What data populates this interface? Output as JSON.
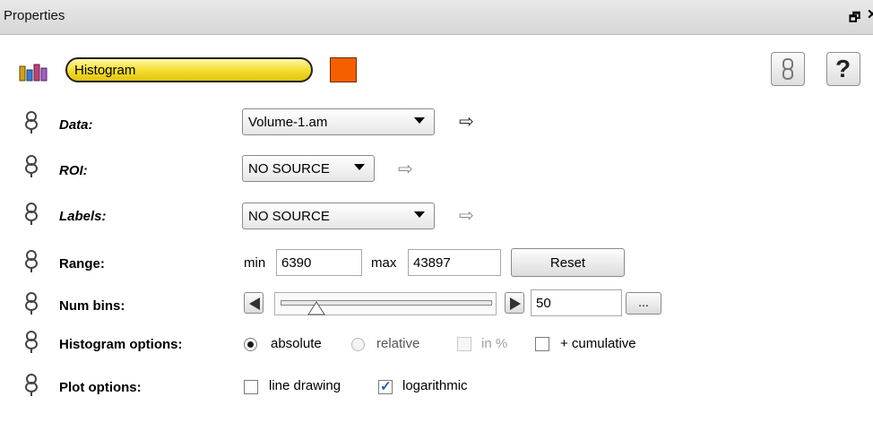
{
  "panel": {
    "title": "Properties"
  },
  "module": {
    "name": "Histogram",
    "color": "#f46000",
    "tool_label": "?"
  },
  "ports": [
    {
      "label": "Data:",
      "value": "Volume-1.am"
    },
    {
      "label": "ROI:",
      "value": "NO SOURCE"
    },
    {
      "label": "Labels:",
      "value": "NO SOURCE"
    }
  ],
  "range": {
    "label": "Range:",
    "min_label": "min",
    "min_value": "6390",
    "max_label": "max",
    "max_value": "43897",
    "reset_label": "Reset"
  },
  "num_bins": {
    "label": "Num bins:",
    "value": "50",
    "more_label": "..."
  },
  "histogram_options": {
    "label": "Histogram options:",
    "absolute": "absolute",
    "relative": "relative",
    "in_percent": "in %",
    "cumulative": "+ cumulative"
  },
  "plot_options": {
    "label": "Plot options:",
    "line_drawing": "line drawing",
    "logarithmic": "logarithmic"
  }
}
